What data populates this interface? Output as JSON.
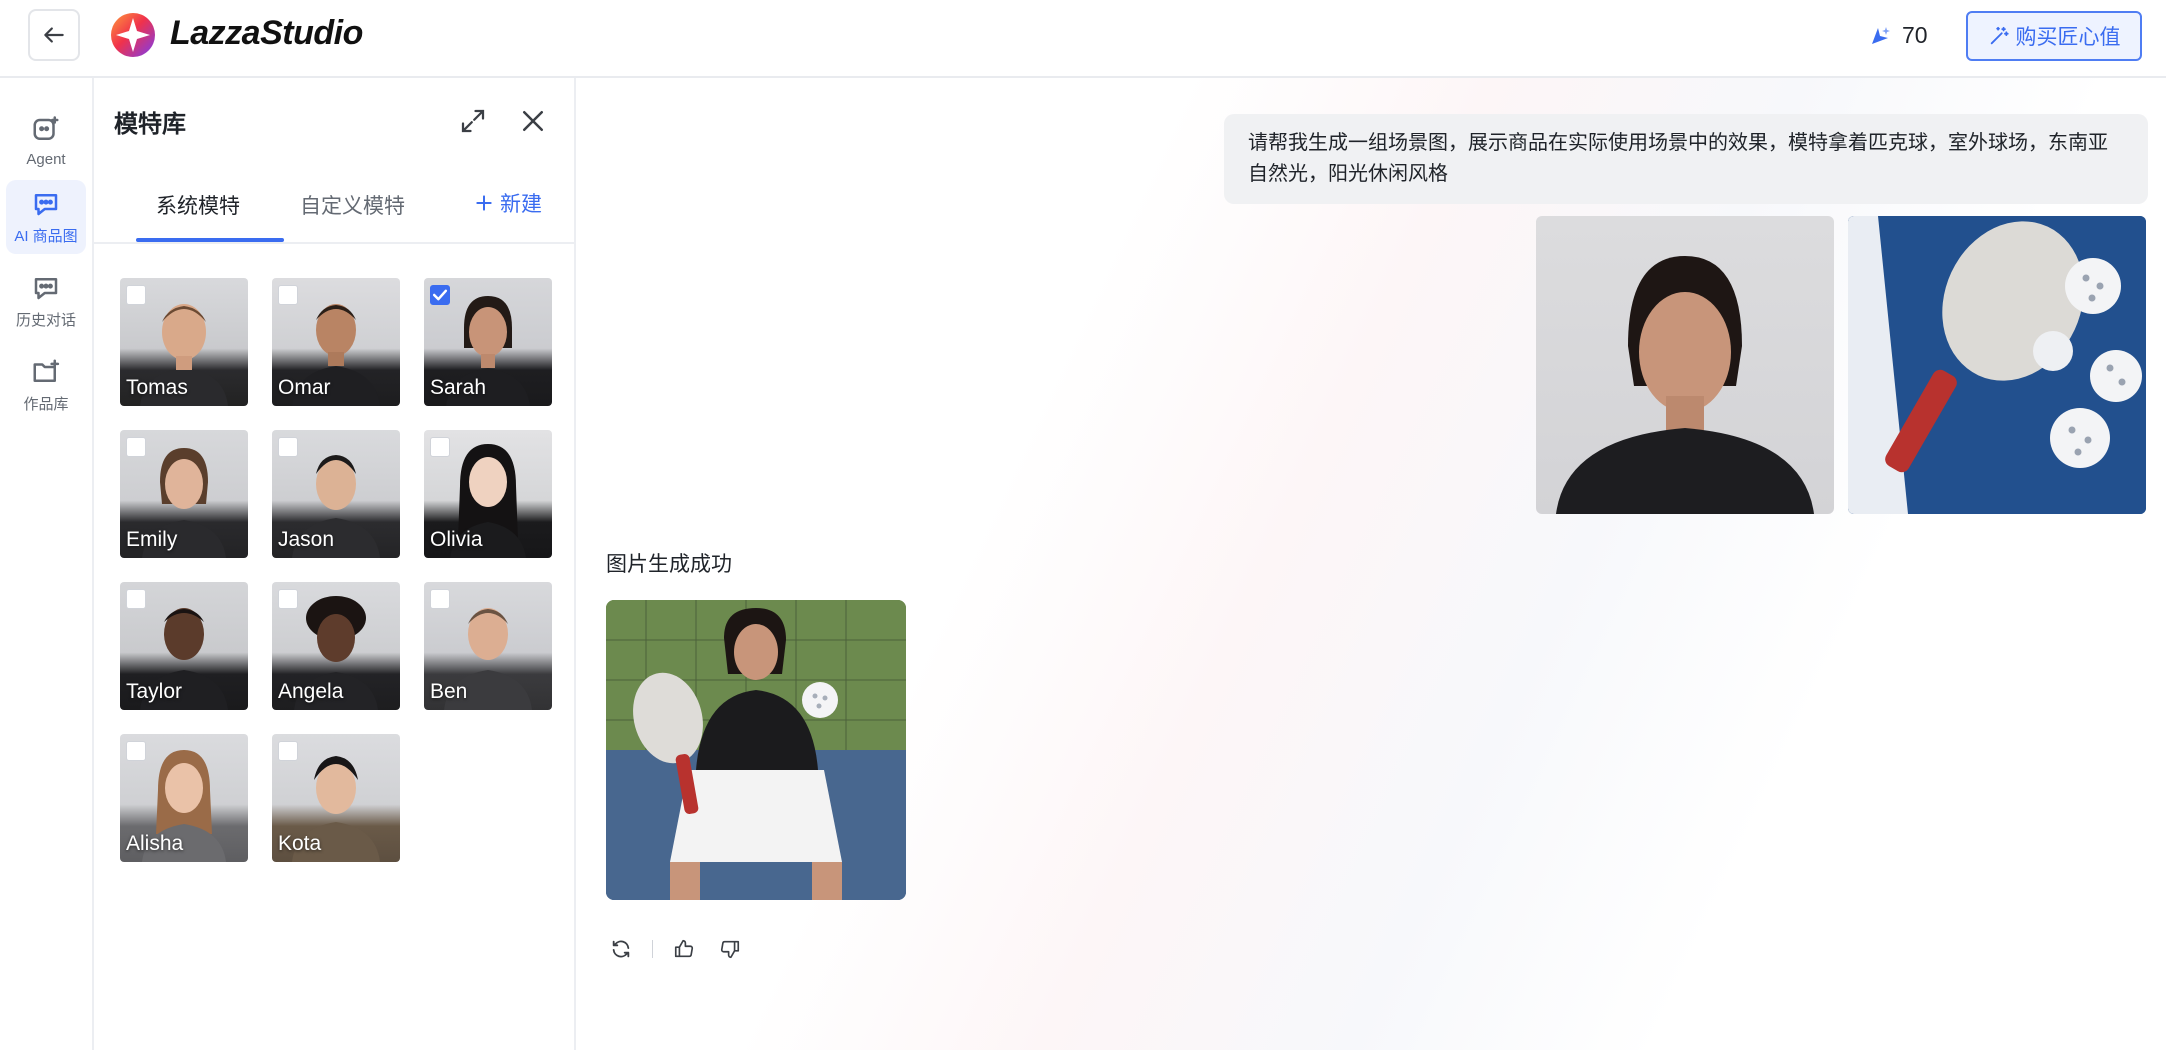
{
  "header": {
    "back_icon": "arrow-left-icon",
    "logo_icon": "lazza-logo-icon",
    "app_name": "LazzaStudio",
    "credit_icon": "sparkle-icon",
    "credits": "70",
    "buy_icon": "magic-wand-icon",
    "buy_label": "购买匠心值",
    "accent_color": "#3a6cf0"
  },
  "rail": {
    "items": [
      {
        "label": "Agent",
        "icon": "agent-icon",
        "active": false
      },
      {
        "label": "AI 商品图",
        "icon": "chat-bubble-icon",
        "active": true
      },
      {
        "label": "历史对话",
        "icon": "history-chat-icon",
        "active": false
      },
      {
        "label": "作品库",
        "icon": "folder-add-icon",
        "active": false
      }
    ]
  },
  "panel": {
    "title": "模特库",
    "expand_icon": "expand-icon",
    "close_icon": "close-icon",
    "tabs": [
      {
        "label": "系统模特",
        "active": true
      },
      {
        "label": "自定义模特",
        "active": false
      }
    ],
    "new_label": "新建",
    "models": [
      {
        "name": "Tomas",
        "checked": false
      },
      {
        "name": "Omar",
        "checked": false
      },
      {
        "name": "Sarah",
        "checked": true
      },
      {
        "name": "Emily",
        "checked": false
      },
      {
        "name": "Jason",
        "checked": false
      },
      {
        "name": "Olivia",
        "checked": false
      },
      {
        "name": "Taylor",
        "checked": false
      },
      {
        "name": "Angela",
        "checked": false
      },
      {
        "name": "Ben",
        "checked": false
      },
      {
        "name": "Alisha",
        "checked": false
      },
      {
        "name": "Kota",
        "checked": false
      }
    ]
  },
  "chat": {
    "prompt": "请帮我生成一组场景图，展示商品在实际使用场景中的效果，模特拿着匹克球，室外球场，东南亚自然光，阳光休闲风格",
    "status": "图片生成成功",
    "actions": [
      {
        "icon": "refresh-icon"
      },
      {
        "icon": "thumbs-up-icon"
      },
      {
        "icon": "thumbs-down-icon"
      }
    ]
  }
}
